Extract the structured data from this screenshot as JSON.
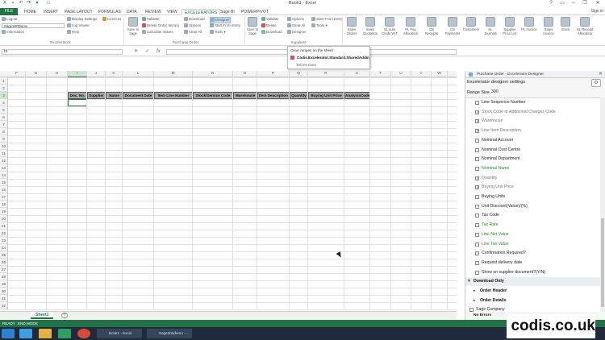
{
  "window": {
    "title": "Book1 - Excel",
    "signin": "Sign in"
  },
  "tabs": [
    "FILE",
    "HOME",
    "INSERT",
    "PAGE LAYOUT",
    "FORMULAS",
    "DATA",
    "REVIEW",
    "VIEW",
    "EXCELERATORS",
    "Sage BI",
    "POWERPIVOT"
  ],
  "active_tab": "EXCELERATORS",
  "ribbon": {
    "excelerators_group": {
      "logout": "Logout",
      "company": "Sage300Demo",
      "information": "Information",
      "display_settings": "Display Settings",
      "log_viewer": "Log Viewer",
      "help": "Help",
      "licences": "Licences",
      "label": "Excelerators"
    },
    "design_group": {
      "save_to_sage": "Save to Sage",
      "validate": "Validate",
      "delete_order_items": "Delete Order Item(s)",
      "calculate_values": "Calculate Values",
      "download": "Download",
      "options": "Options",
      "clear_all": "Clear All",
      "designer": "Designer",
      "start_from_entry": "Start From Entry",
      "tools": "Tools",
      "label": "Purchase Order"
    },
    "suppliers_group": {
      "save_to_sage": "Save to Sage",
      "validate": "Validate",
      "delete": "Delete",
      "download": "Download",
      "options": "Options",
      "clear_all": "Clear All",
      "designer": "Designer",
      "start_from_entry": "Start From Entry",
      "tools": "Tools",
      "label": "Suppliers"
    },
    "big_buttons": [
      "Sales Orders",
      "Sales Quotation",
      "SL auto Credit VAT",
      "PL Pay Allocation",
      "CB Receipts",
      "CB Payments",
      "Customers",
      "NL Journals",
      "Supplier Price List",
      "PL Invoice",
      "Sales Invoice",
      "Stock",
      "SL Receipt Allocation"
    ]
  },
  "tooltip": {
    "heading": "Clear ranges on the sheet",
    "addin": "Codis.Excelerator.Standard.SharedAddin",
    "more": "Tell me more"
  },
  "formula_bar": {
    "name_box": "I3",
    "cancel": "✕",
    "enter": "✓",
    "fx": "fx"
  },
  "columns": [
    "F",
    "G",
    "H",
    "I",
    "J",
    "K",
    "L",
    "M",
    "N",
    "O",
    "P",
    "Q",
    "R",
    "S",
    "T",
    "U",
    "V",
    "W"
  ],
  "selected_column": "I",
  "rows": [
    "1",
    "2",
    "3",
    "4",
    "5",
    "6",
    "7",
    "8",
    "9",
    "10",
    "11",
    "12",
    "13",
    "14",
    "15",
    "16",
    "17",
    "18",
    "19",
    "20",
    "21",
    "22",
    "23",
    "24",
    "25",
    "26",
    "27",
    "28",
    "29",
    "30",
    "31",
    "32",
    "33",
    "34",
    "35",
    "36"
  ],
  "selected_row": "3",
  "header_cells": [
    "Doc. No.",
    "Supplier",
    "Name",
    "Document Date",
    "Item Line Number",
    "Stock/Service Code",
    "Warehouse",
    "Item Description",
    "Quantity",
    "Buying Unit Price",
    "AnalysisCode1"
  ],
  "sheets": {
    "active": "Sheet1",
    "add": "+"
  },
  "status": {
    "ready": "READY",
    "end_mode": "END MODE"
  },
  "taskbar": {
    "window1": "Book1 - Excel",
    "window2": "Sage300demo - ..."
  },
  "brand": "codis.co.uk",
  "pane": {
    "title": "Purchase Order - Excelerator Designer",
    "close": "✕",
    "settings_label": "Excelerator designer settings",
    "range_label": "Range Size",
    "range_value": "300",
    "fields": [
      {
        "label": "Line Sequence Number",
        "checked": false,
        "kind": "opt"
      },
      {
        "label": "Stock Code or Additional Charges Code",
        "checked": true,
        "kind": "on"
      },
      {
        "label": "Warehouse",
        "checked": true,
        "kind": "on"
      },
      {
        "label": "Line Item Description",
        "checked": true,
        "kind": "on"
      },
      {
        "label": "Nominal Account",
        "checked": false,
        "kind": "opt"
      },
      {
        "label": "Nominal Cost Centre",
        "checked": false,
        "kind": "opt"
      },
      {
        "label": "Nominal Department",
        "checked": false,
        "kind": "opt"
      },
      {
        "label": "Nominal Name",
        "checked": false,
        "kind": "req"
      },
      {
        "label": "Quantity",
        "checked": true,
        "kind": "on"
      },
      {
        "label": "Buying Unit Price",
        "checked": true,
        "kind": "on"
      },
      {
        "label": "Buying Units",
        "checked": false,
        "kind": "opt"
      },
      {
        "label": "Unit Discount(Value)/(%)",
        "checked": false,
        "kind": "opt"
      },
      {
        "label": "Tax Code",
        "checked": false,
        "kind": "opt"
      },
      {
        "label": "Tax Rate",
        "checked": false,
        "kind": "req"
      },
      {
        "label": "Line Net Value",
        "checked": false,
        "kind": "req"
      },
      {
        "label": "Line Tax Value",
        "checked": false,
        "kind": "req"
      },
      {
        "label": "Confirmation Required?",
        "checked": false,
        "kind": "opt"
      },
      {
        "label": "Request delivery date",
        "checked": false,
        "kind": "opt"
      },
      {
        "label": "Show on supplier document?(Y/N)",
        "checked": false,
        "kind": "opt"
      }
    ],
    "section_download": "Download Only",
    "sub_order_header": "Order Header",
    "sub_order_details": "Order Details",
    "sage_company": "Sage Company",
    "errors": "No Errors"
  },
  "colors": {
    "excel_green": "#217346",
    "header_fill": "#a9a9a9",
    "required_field": "#2a8a2a"
  }
}
